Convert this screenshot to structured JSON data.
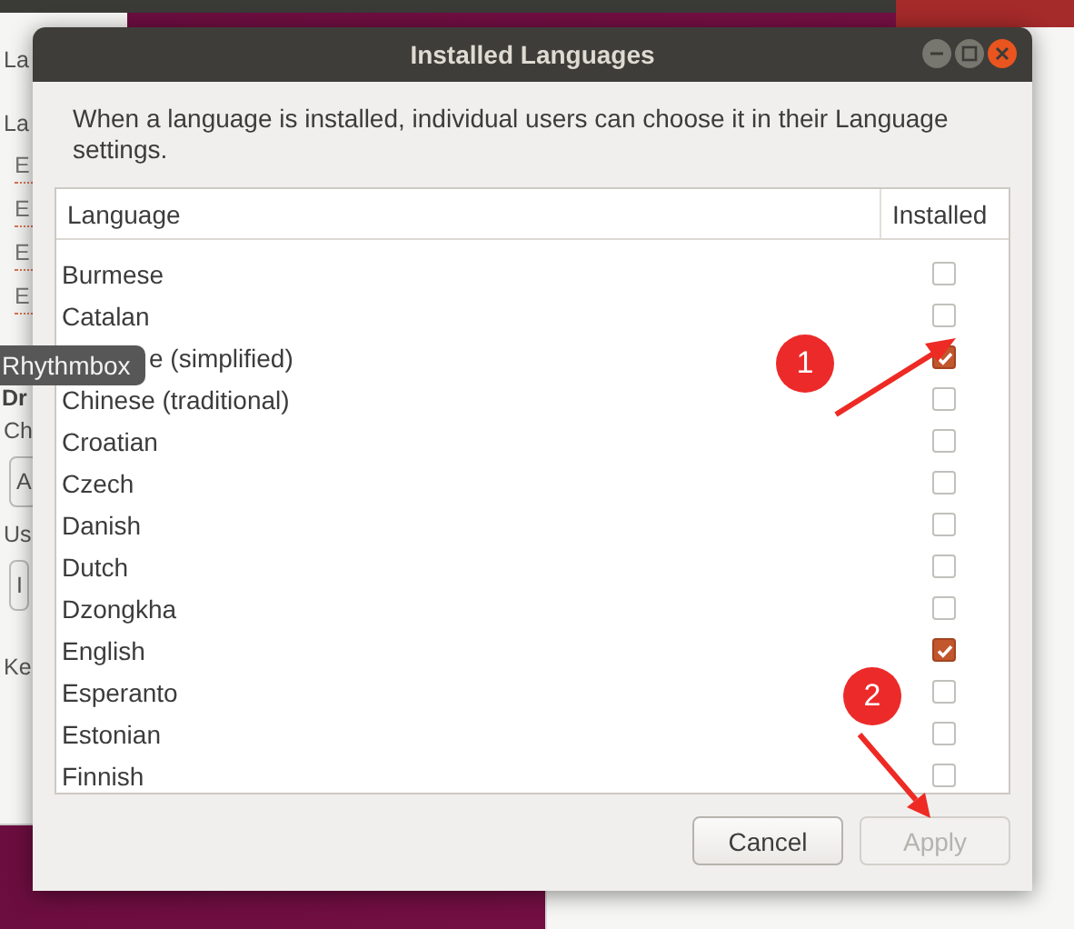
{
  "background_window": {
    "fragments": [
      {
        "kind": "header",
        "text": "La"
      },
      {
        "kind": "text",
        "text": "La"
      },
      {
        "kind": "entry",
        "text": "E"
      },
      {
        "kind": "entry",
        "text": "E"
      },
      {
        "kind": "entry",
        "text": "E"
      },
      {
        "kind": "entry",
        "text": "E"
      },
      {
        "kind": "bold",
        "text": "Dr"
      },
      {
        "kind": "text",
        "text": "Ch"
      },
      {
        "kind": "button",
        "text": "A"
      },
      {
        "kind": "text",
        "text": "Us"
      },
      {
        "kind": "button",
        "text": "I"
      },
      {
        "kind": "text",
        "text": "Ke"
      }
    ]
  },
  "tooltip": {
    "text": "Rhythmbox"
  },
  "dialog": {
    "title": "Installed Languages",
    "description": "When a language is installed, individual users can choose it in their Language settings.",
    "table": {
      "columns": [
        "Language",
        "Installed"
      ],
      "rows": [
        {
          "language": "Burmese",
          "installed": false
        },
        {
          "language": "Catalan",
          "installed": false
        },
        {
          "language": "e (simplified)",
          "installed": true,
          "covered_by_tooltip": true
        },
        {
          "language": "Chinese (traditional)",
          "installed": false
        },
        {
          "language": "Croatian",
          "installed": false
        },
        {
          "language": "Czech",
          "installed": false
        },
        {
          "language": "Danish",
          "installed": false
        },
        {
          "language": "Dutch",
          "installed": false
        },
        {
          "language": "Dzongkha",
          "installed": false
        },
        {
          "language": "English",
          "installed": true
        },
        {
          "language": "Esperanto",
          "installed": false
        },
        {
          "language": "Estonian",
          "installed": false
        },
        {
          "language": "Finnish",
          "installed": false
        }
      ]
    },
    "buttons": [
      {
        "label": "Cancel",
        "disabled": false
      },
      {
        "label": "Apply",
        "disabled": true
      }
    ]
  },
  "annotations": [
    {
      "label": "1"
    },
    {
      "label": "2"
    }
  ]
}
